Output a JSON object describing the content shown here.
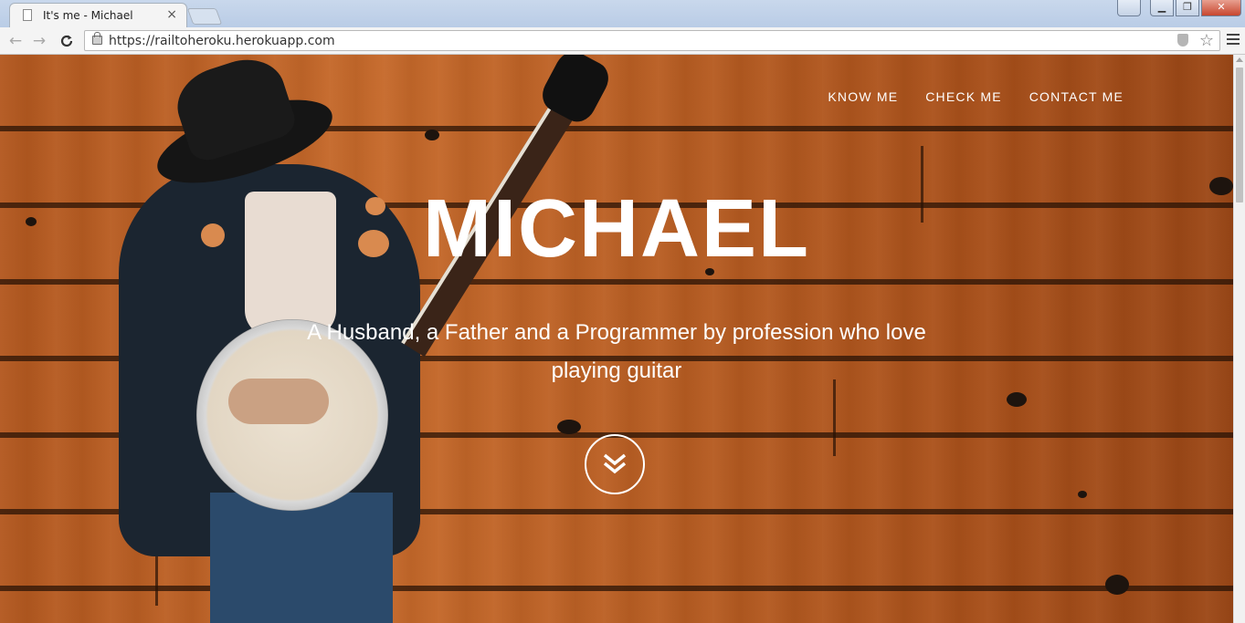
{
  "browser": {
    "tab_title": "It's me - Michael",
    "tab_close_glyph": "×",
    "url_scheme": "https://",
    "url_host": "railtoheroku.herokuapp.com",
    "back_glyph": "←",
    "forward_glyph": "→",
    "reload_glyph": "C",
    "star_glyph": "☆",
    "window_controls": {
      "minimize": "▁",
      "maximize": "❐",
      "close": "✕"
    },
    "icons": [
      "page-favicon-icon",
      "lock-icon",
      "shield-icon",
      "star-icon",
      "menu-icon"
    ]
  },
  "site": {
    "nav": {
      "know_me": "KNOW ME",
      "check_me": "CHECK ME",
      "contact_me": "CONTACT ME"
    },
    "hero": {
      "title": "MICHAEL",
      "subtitle": "A Husband, a Father and a Programmer by profession who love playing guitar",
      "scroll_icon": "double-chevron-down-icon"
    },
    "colors": {
      "text": "#ffffff",
      "wood": "#c76a2b"
    }
  }
}
